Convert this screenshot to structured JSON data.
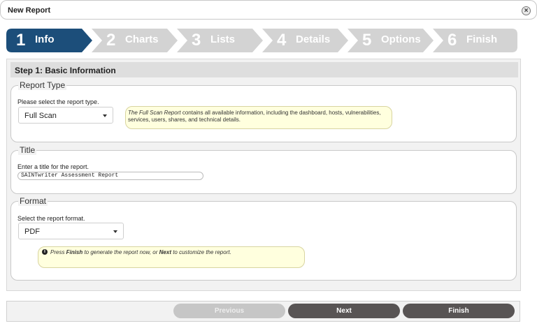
{
  "dialog": {
    "title": "New Report",
    "close_glyph": "×"
  },
  "wizard": {
    "steps": [
      {
        "num": "1",
        "label": "Info"
      },
      {
        "num": "2",
        "label": "Charts"
      },
      {
        "num": "3",
        "label": "Lists"
      },
      {
        "num": "4",
        "label": "Details"
      },
      {
        "num": "5",
        "label": "Options"
      },
      {
        "num": "6",
        "label": "Finish"
      }
    ],
    "active_color": "#1c4e7a",
    "inactive_color": "#d3d3d3"
  },
  "panel": {
    "heading": "Step 1: Basic Information"
  },
  "report_type": {
    "legend": "Report Type",
    "hint": "Please select the report type.",
    "selected": "Full Scan",
    "note_em": "The Full Scan Report",
    "note_rest": " contains all available information, including the dashboard, hosts, vulnerabilities, services, users, shares, and technical details."
  },
  "title_section": {
    "legend": "Title",
    "hint": "Enter a title for the report.",
    "value": "SAINTwriter Assessment Report"
  },
  "format": {
    "legend": "Format",
    "hint": "Select the report format.",
    "selected": "PDF",
    "info_icon": "info-icon",
    "note_a": "Press ",
    "note_b": "Finish",
    "note_c": " to generate the report now, or ",
    "note_d": "Next",
    "note_e": " to customize the report."
  },
  "buttons": {
    "previous": "Previous",
    "next": "Next",
    "finish": "Finish"
  }
}
